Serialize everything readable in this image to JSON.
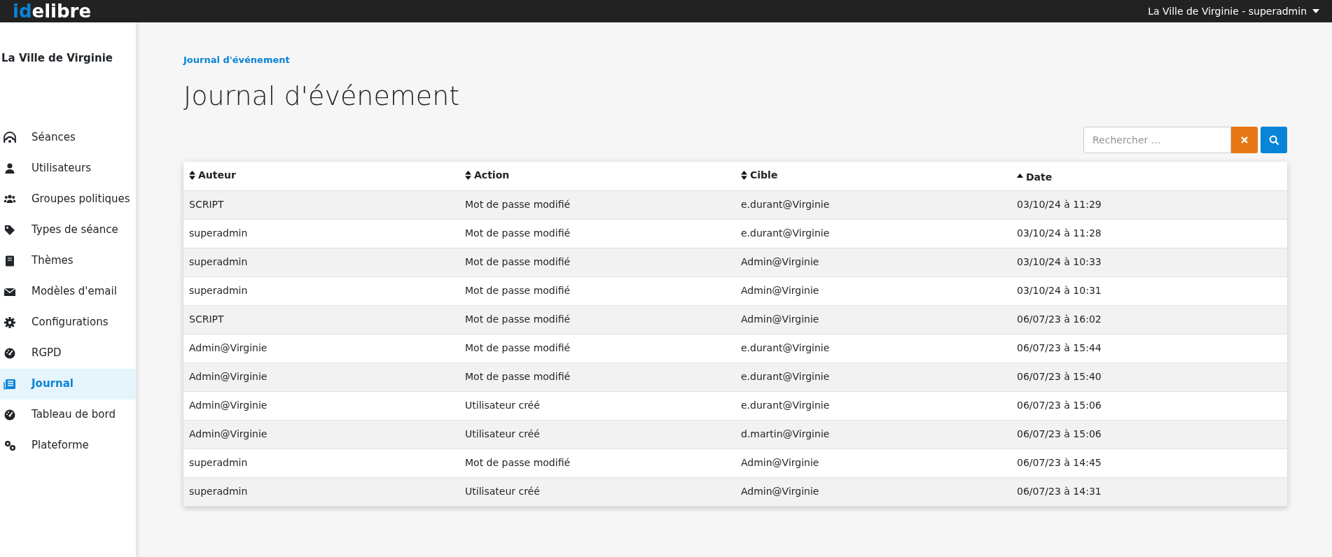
{
  "navbar": {
    "logo_accent": "id",
    "logo_rest": "elibre",
    "user_menu": "La Ville de Virginie - superadmin"
  },
  "sidebar": {
    "title": "La Ville de Virginie",
    "items": [
      {
        "label": "Séances",
        "selected": false
      },
      {
        "label": "Utilisateurs",
        "selected": false
      },
      {
        "label": "Groupes politiques",
        "selected": false
      },
      {
        "label": "Types de séance",
        "selected": false
      },
      {
        "label": "Thèmes",
        "selected": false
      },
      {
        "label": "Modèles d'email",
        "selected": false
      },
      {
        "label": "Configurations",
        "selected": false
      },
      {
        "label": "RGPD",
        "selected": false
      },
      {
        "label": "Journal",
        "selected": true
      },
      {
        "label": "Tableau de bord",
        "selected": false
      },
      {
        "label": "Plateforme",
        "selected": false
      }
    ]
  },
  "breadcrumb": "Journal d'événement",
  "page_title": "Journal d'événement",
  "search": {
    "placeholder": "Rechercher ..."
  },
  "table": {
    "columns": [
      {
        "label": "Auteur",
        "sorted": false
      },
      {
        "label": "Action",
        "sorted": false
      },
      {
        "label": "Cible",
        "sorted": false
      },
      {
        "label": "Date",
        "sorted": true
      }
    ],
    "rows": [
      [
        "SCRIPT",
        "Mot de passe modifié",
        "e.durant@Virginie",
        "03/10/24 à 11:29"
      ],
      [
        "superadmin",
        "Mot de passe modifié",
        "e.durant@Virginie",
        "03/10/24 à 11:28"
      ],
      [
        "superadmin",
        "Mot de passe modifié",
        "Admin@Virginie",
        "03/10/24 à 10:33"
      ],
      [
        "superadmin",
        "Mot de passe modifié",
        "Admin@Virginie",
        "03/10/24 à 10:31"
      ],
      [
        "SCRIPT",
        "Mot de passe modifié",
        "Admin@Virginie",
        "06/07/23 à 16:02"
      ],
      [
        "Admin@Virginie",
        "Mot de passe modifié",
        "e.durant@Virginie",
        "06/07/23 à 15:44"
      ],
      [
        "Admin@Virginie",
        "Mot de passe modifié",
        "e.durant@Virginie",
        "06/07/23 à 15:40"
      ],
      [
        "Admin@Virginie",
        "Utilisateur créé",
        "e.durant@Virginie",
        "06/07/23 à 15:06"
      ],
      [
        "Admin@Virginie",
        "Utilisateur créé",
        "d.martin@Virginie",
        "06/07/23 à 15:06"
      ],
      [
        "superadmin",
        "Mot de passe modifié",
        "Admin@Virginie",
        "06/07/23 à 14:45"
      ],
      [
        "superadmin",
        "Utilisateur créé",
        "Admin@Virginie",
        "06/07/23 à 14:31"
      ]
    ]
  }
}
